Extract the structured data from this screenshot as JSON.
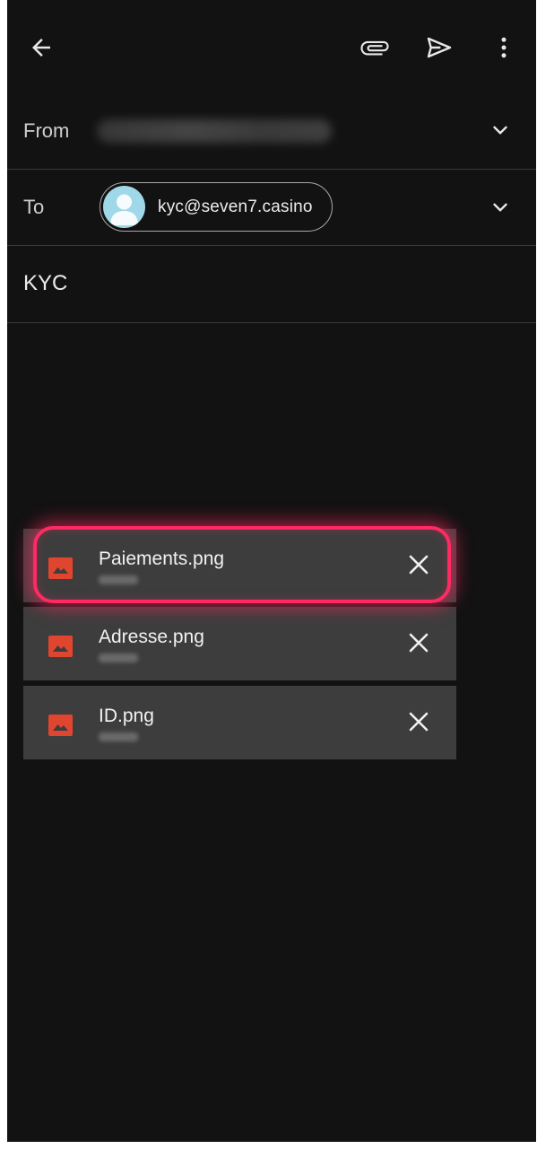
{
  "appbar": {
    "back_icon": "arrow-left-icon",
    "attach_icon": "paperclip-icon",
    "send_icon": "send-icon",
    "more_icon": "more-vert-icon"
  },
  "from": {
    "label": "From",
    "value_blurred": true
  },
  "to": {
    "label": "To",
    "recipient": "kyc@seven7.casino",
    "avatar_color": "#9fd8e8"
  },
  "subject": "KYC",
  "attachments": [
    {
      "name": "Paiements.png",
      "icon": "image-file-icon",
      "highlighted": true
    },
    {
      "name": "Adresse.png",
      "icon": "image-file-icon",
      "highlighted": false
    },
    {
      "name": "ID.png",
      "icon": "image-file-icon",
      "highlighted": false
    }
  ],
  "colors": {
    "background": "#121212",
    "attachment_bg": "#3d3d3d",
    "image_icon": "#e0452f",
    "highlight": "#ff2a63"
  }
}
